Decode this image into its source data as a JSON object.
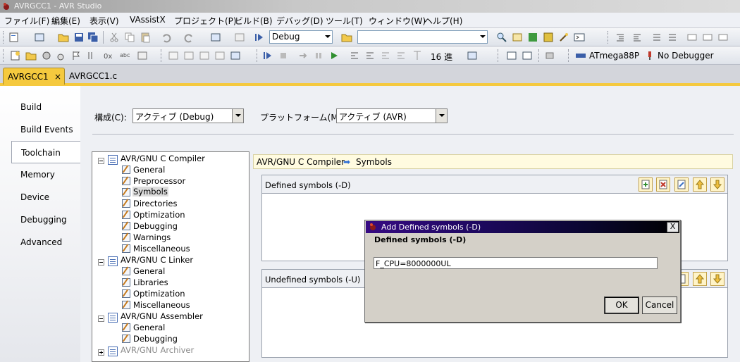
{
  "window": {
    "title": "AVRGCC1 - AVR Studio"
  },
  "menu": [
    "ファイル(F)",
    "編集(E)",
    "表示(V)",
    "VAssistX",
    "プロジェクト(P)",
    "ビルド(B)",
    "デバッグ(D)",
    "ツール(T)",
    "ウィンドウ(W)",
    "ヘルプ(H)"
  ],
  "toolbar1": {
    "config_value": "Debug",
    "platform_value": ""
  },
  "toolbar2": {
    "radix_label": "16 進",
    "device_label": "ATmega88P",
    "debugger_label": "No Debugger"
  },
  "doctabs": [
    "AVRGCC1",
    "AVRGCC1.c"
  ],
  "doctab_close": "×",
  "sidebar": [
    "Build",
    "Build Events",
    "Toolchain",
    "Memory",
    "Device",
    "Debugging",
    "Advanced"
  ],
  "config": {
    "config_label": "構成(C):",
    "config_value": "アクティブ (Debug)",
    "platform_label": "プラットフォーム(M):",
    "platform_value": "アクティブ (AVR)"
  },
  "tree": [
    {
      "label": "AVR/GNU C Compiler",
      "children": [
        "General",
        "Preprocessor",
        "Symbols",
        "Directories",
        "Optimization",
        "Debugging",
        "Warnings",
        "Miscellaneous"
      ]
    },
    {
      "label": "AVR/GNU C Linker",
      "children": [
        "General",
        "Libraries",
        "Optimization",
        "Miscellaneous"
      ]
    },
    {
      "label": "AVR/GNU Assembler",
      "children": [
        "General",
        "Debugging"
      ]
    },
    {
      "label": "AVR/GNU Archiver",
      "children": []
    }
  ],
  "breadcrumb": {
    "parent": "AVR/GNU C Compiler",
    "arrow": "➡",
    "current": "Symbols"
  },
  "groups": {
    "defined": "Defined symbols (-D)",
    "undefined": "Undefined symbols (-U)"
  },
  "dialog": {
    "title": "Add Defined symbols (-D)",
    "label": "Defined symbols (-D)",
    "value": "F_CPU=8000000UL",
    "ok": "OK",
    "cancel": "Cancel",
    "close": "X"
  },
  "colors": {
    "tab_accent": "#f5c93e",
    "dialog_title": "#360a82",
    "selection": "#dcdcdc"
  }
}
